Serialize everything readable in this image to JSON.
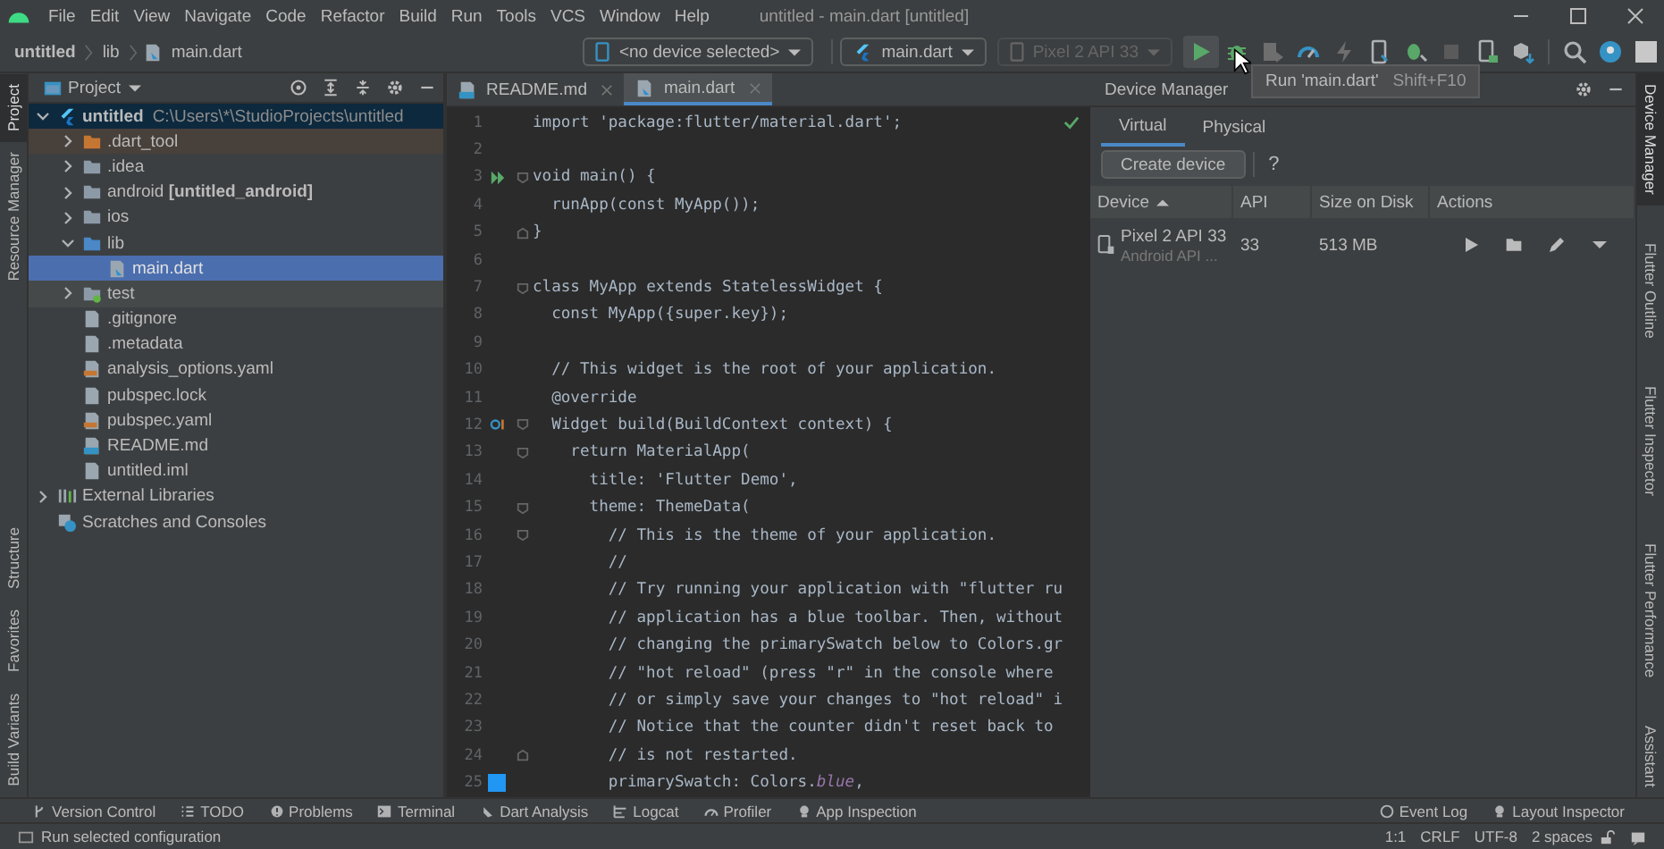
{
  "menu": [
    {
      "label": "File"
    },
    {
      "label": "Edit"
    },
    {
      "label": "View"
    },
    {
      "label": "Navigate"
    },
    {
      "label": "Code"
    },
    {
      "label": "Refactor"
    },
    {
      "label": "Build"
    },
    {
      "label": "Run"
    },
    {
      "label": "Tools"
    },
    {
      "label": "VCS"
    },
    {
      "label": "Window"
    },
    {
      "label": "Help"
    }
  ],
  "window": {
    "title": "untitled - main.dart [untitled]"
  },
  "breadcrumb": [
    {
      "label": "untitled",
      "kind": "project"
    },
    {
      "label": "lib",
      "kind": "folder"
    },
    {
      "label": "main.dart",
      "kind": "dart-file"
    }
  ],
  "toolbar": {
    "device_selector": {
      "label": "<no device selected>"
    },
    "run_config": {
      "label": "main.dart"
    },
    "target": {
      "label": "Pixel 2 API 33",
      "disabled": true
    },
    "run_hovered": true
  },
  "tooltip": {
    "label": "Run 'main.dart'",
    "shortcut": "Shift+F10"
  },
  "left_tabs": [
    {
      "label": "Project",
      "selected": true
    },
    {
      "label": "Resource Manager",
      "selected": false
    },
    {
      "label": "Structure",
      "selected": false
    },
    {
      "label": "Favorites",
      "selected": false
    },
    {
      "label": "Build Variants",
      "selected": false
    }
  ],
  "right_tabs": [
    {
      "label": "Device Manager",
      "selected": true
    },
    {
      "label": "Flutter Outline",
      "selected": false
    },
    {
      "label": "Flutter Inspector",
      "selected": false
    },
    {
      "label": "Flutter Performance",
      "selected": false
    },
    {
      "label": "Assistant",
      "selected": false
    }
  ],
  "project": {
    "title": "Project",
    "tree": [
      {
        "label": "untitled",
        "path": "C:\\Users\\*\\StudioProjects\\untitled",
        "kind": "module",
        "expanded": true,
        "selected": false,
        "children": [
          {
            "label": ".dart_tool",
            "kind": "excluded-folder",
            "expanded": false,
            "selected": false
          },
          {
            "label": ".idea",
            "kind": "folder",
            "expanded": false,
            "selected": false
          },
          {
            "label": "android **[untitled_android]**",
            "kind": "folder",
            "expanded": false,
            "selected": false
          },
          {
            "label": "ios",
            "kind": "folder",
            "expanded": false,
            "selected": false
          },
          {
            "label": "lib",
            "kind": "source-folder",
            "expanded": true,
            "selected": false,
            "children": [
              {
                "label": "main.dart",
                "kind": "dart-file",
                "selected": true
              }
            ]
          },
          {
            "label": "test",
            "kind": "test-folder",
            "expanded": false,
            "selected": false
          },
          {
            "label": ".gitignore",
            "kind": "file",
            "selected": false
          },
          {
            "label": ".metadata",
            "kind": "file",
            "selected": false
          },
          {
            "label": "analysis_options.yaml",
            "kind": "yaml-file",
            "selected": false
          },
          {
            "label": "pubspec.lock",
            "kind": "file",
            "selected": false
          },
          {
            "label": "pubspec.yaml",
            "kind": "yaml-file",
            "selected": false
          },
          {
            "label": "README.md",
            "kind": "markdown-file",
            "selected": false
          },
          {
            "label": "untitled.iml",
            "kind": "file",
            "selected": false
          }
        ]
      },
      {
        "label": "External Libraries",
        "kind": "libraries",
        "expanded": false,
        "selected": false
      },
      {
        "label": "Scratches and Consoles",
        "kind": "scratches",
        "selected": false
      }
    ]
  },
  "editor": {
    "tabs": [
      {
        "label": "README.md",
        "kind": "markdown-file",
        "selected": false
      },
      {
        "label": "main.dart",
        "kind": "dart-file",
        "selected": true
      }
    ],
    "lines": [
      {
        "n": "1",
        "segs": [
          {
            "kind": "keyword",
            "t": "import "
          },
          {
            "kind": "string",
            "t": "'package:flutter/material.dart'"
          },
          {
            "kind": "keyword",
            "t": ";"
          }
        ]
      },
      {
        "n": "2"
      },
      {
        "n": "3",
        "marker": {
          "kind": "run"
        },
        "fold": {
          "kind": "start"
        },
        "segs": [
          {
            "kind": "keyword",
            "t": "void "
          },
          {
            "kind": "plain",
            "t": "main() {"
          }
        ]
      },
      {
        "n": "4",
        "segs": [
          {
            "kind": "plain",
            "t": "  runApp("
          },
          {
            "kind": "keyword",
            "t": "const "
          },
          {
            "kind": "plain",
            "t": "MyApp())"
          },
          {
            "kind": "keyword",
            "t": ";"
          }
        ]
      },
      {
        "n": "5",
        "fold": {
          "kind": "end"
        },
        "segs": [
          {
            "kind": "plain",
            "t": "}"
          }
        ]
      },
      {
        "n": "6"
      },
      {
        "n": "7",
        "fold": {
          "kind": "start"
        },
        "segs": [
          {
            "kind": "keyword",
            "t": "class "
          },
          {
            "kind": "plain",
            "t": "MyApp "
          },
          {
            "kind": "keyword",
            "t": "extends "
          },
          {
            "kind": "plain",
            "t": "StatelessWidget {"
          }
        ]
      },
      {
        "n": "8",
        "segs": [
          {
            "kind": "keyword",
            "t": "  const "
          },
          {
            "kind": "plain",
            "t": "MyApp({"
          },
          {
            "kind": "keyword",
            "t": "super"
          },
          {
            "kind": "plain",
            "t": ".key})"
          },
          {
            "kind": "keyword",
            "t": ";"
          }
        ]
      },
      {
        "n": "9"
      },
      {
        "n": "10",
        "segs": [
          {
            "kind": "comment",
            "t": "  // This widget is the root of your application."
          }
        ]
      },
      {
        "n": "11",
        "segs": [
          {
            "kind": "annotation",
            "t": "  @override"
          }
        ]
      },
      {
        "n": "12",
        "marker": {
          "kind": "override"
        },
        "fold": {
          "kind": "start"
        },
        "segs": [
          {
            "kind": "plain",
            "t": "  Widget build(BuildContext context) {"
          }
        ]
      },
      {
        "n": "13",
        "fold": {
          "kind": "start"
        },
        "segs": [
          {
            "kind": "keyword",
            "t": "    return "
          },
          {
            "kind": "function",
            "t": "MaterialApp"
          },
          {
            "kind": "plain",
            "t": "("
          }
        ]
      },
      {
        "n": "14",
        "segs": [
          {
            "kind": "plain",
            "t": "      title: "
          },
          {
            "kind": "string",
            "t": "'Flutter Demo'"
          },
          {
            "kind": "keyword",
            "t": ","
          }
        ]
      },
      {
        "n": "15",
        "fold": {
          "kind": "start"
        },
        "segs": [
          {
            "kind": "plain",
            "t": "      theme: "
          },
          {
            "kind": "function",
            "t": "ThemeData"
          },
          {
            "kind": "plain",
            "t": "("
          }
        ]
      },
      {
        "n": "16",
        "fold": {
          "kind": "start"
        },
        "segs": [
          {
            "kind": "comment",
            "t": "        // This is the theme of your application."
          }
        ]
      },
      {
        "n": "17",
        "segs": [
          {
            "kind": "comment",
            "t": "        //"
          }
        ]
      },
      {
        "n": "18",
        "segs": [
          {
            "kind": "comment",
            "t": "        // Try running your application with \"flutter ru"
          }
        ]
      },
      {
        "n": "19",
        "segs": [
          {
            "kind": "comment",
            "t": "        // application has a blue toolbar. Then, without"
          }
        ]
      },
      {
        "n": "20",
        "segs": [
          {
            "kind": "comment",
            "t": "        // changing the primarySwatch below to Colors.gr"
          }
        ]
      },
      {
        "n": "21",
        "segs": [
          {
            "kind": "comment",
            "t": "        // \"hot reload\" (press \"r\" in the console where"
          }
        ]
      },
      {
        "n": "22",
        "segs": [
          {
            "kind": "comment",
            "t": "        // or simply save your changes to \"hot reload\" i"
          }
        ]
      },
      {
        "n": "23",
        "segs": [
          {
            "kind": "comment",
            "t": "        // Notice that the counter didn't reset back to"
          }
        ]
      },
      {
        "n": "24",
        "fold": {
          "kind": "end"
        },
        "segs": [
          {
            "kind": "comment",
            "t": "        // is not restarted."
          }
        ]
      },
      {
        "n": "25",
        "marker": {
          "kind": "color-swatch"
        },
        "segs": [
          {
            "kind": "plain",
            "t": "        primarySwatch: Colors."
          },
          {
            "kind": "field",
            "t": "blue"
          },
          {
            "kind": "keyword",
            "t": ","
          }
        ]
      }
    ]
  },
  "device_manager": {
    "title": "Device Manager",
    "tabs": [
      {
        "label": "Virtual",
        "selected": true
      },
      {
        "label": "Physical",
        "selected": false
      }
    ],
    "create_button": "Create device",
    "help": "?",
    "columns": [
      {
        "label": "Device",
        "sorted": true
      },
      {
        "label": "API",
        "sorted": false
      },
      {
        "label": "Size on Disk",
        "sorted": false
      },
      {
        "label": "Actions",
        "sorted": false
      }
    ],
    "devices": [
      {
        "name": "Pixel 2 API 33",
        "subtitle": "Android API ...",
        "api": "33",
        "size": "513 MB"
      }
    ]
  },
  "bottom_tools": [
    {
      "label": "Version Control",
      "kind": "branch"
    },
    {
      "label": "TODO",
      "kind": "list"
    },
    {
      "label": "Problems",
      "kind": "warning"
    },
    {
      "label": "Terminal",
      "kind": "terminal"
    },
    {
      "label": "Dart Analysis",
      "kind": "dart"
    },
    {
      "label": "Logcat",
      "kind": "log"
    },
    {
      "label": "Profiler",
      "kind": "gauge"
    },
    {
      "label": "App Inspection",
      "kind": "inspect"
    }
  ],
  "bottom_tools_right": [
    {
      "label": "Event Log",
      "kind": "bubble"
    },
    {
      "label": "Layout Inspector",
      "kind": "inspect"
    }
  ],
  "status": {
    "message": "Run selected configuration",
    "items": [
      "1:1",
      "CRLF",
      "UTF-8",
      "2 spaces"
    ]
  }
}
